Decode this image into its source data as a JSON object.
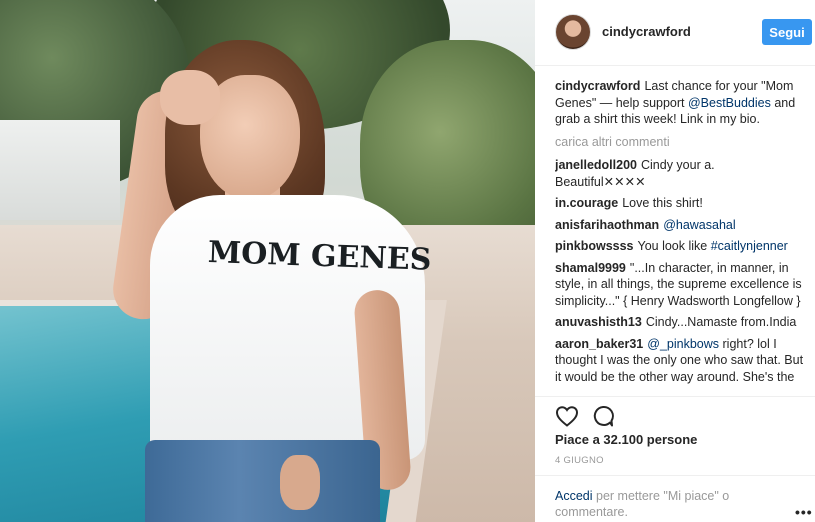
{
  "post": {
    "shirt_print": "MOM GENES"
  },
  "header": {
    "username": "cindycrawford",
    "follow_label": "Segui"
  },
  "caption": {
    "author": "cindycrawford",
    "text_before": "Last chance for your \"Mom Genes\" — help support ",
    "mention": "@BestBuddies",
    "text_after": " and grab a shirt this week! Link in my bio."
  },
  "load_more": "carica altri commenti",
  "comments": [
    {
      "author": "janelledoll200",
      "text": "Cindy your a. Beautiful✕✕✕✕",
      "link": ""
    },
    {
      "author": "in.courage",
      "text": "Love this shirt!",
      "link": ""
    },
    {
      "author": "anisfarihaothman",
      "text": "",
      "link": "@hawasahal"
    },
    {
      "author": "pinkbowssss",
      "text": "You look like ",
      "link": "#caitlynjenner"
    },
    {
      "author": "shamal9999",
      "text": "\"...In character, in manner, in style, in all things, the supreme excellence is simplicity...\" { Henry Wadsworth Longfellow }",
      "link": ""
    },
    {
      "author": "anuvashisth13",
      "text": "Cindy...Namaste from.India",
      "link": ""
    },
    {
      "author": "aaron_baker31",
      "link": "@_pinkbows",
      "text": " right? lol I thought I was the only one who saw that. But it would be the other way around. She's the"
    }
  ],
  "icons": {
    "like": "heart-icon",
    "comment": "comment-icon",
    "options": "more-options-icon"
  },
  "likes": "Piace a 32.100 persone",
  "date": "4 GIUGNO",
  "footer": {
    "login": "Accedi",
    "text": " per mettere \"Mi piace\" o commentare.",
    "more": "•••"
  }
}
